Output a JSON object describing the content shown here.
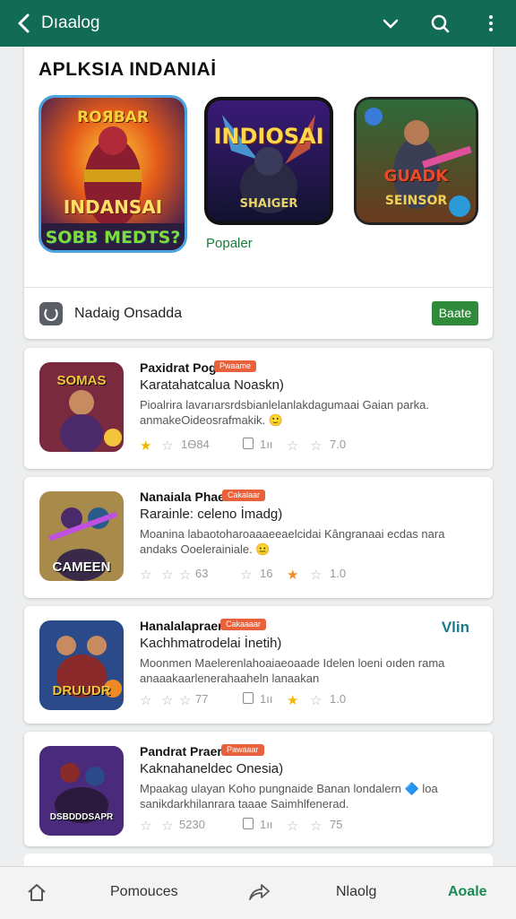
{
  "topbar": {
    "title": "Dıaalog",
    "bg": "#126b55",
    "icons": [
      "back-arrow-icon",
      "chevron-down-icon",
      "search-icon",
      "more-vert-icon"
    ]
  },
  "featured": {
    "heading": "APLKSIA INDANIAİ",
    "banners": [
      {
        "top": "ROЯBAR",
        "mid": "INDANSAI",
        "bottom": "SOBB MEDTS?"
      },
      {
        "top": "INDIOSAI",
        "bottom": "SHAIGER"
      },
      {
        "top": "GUADK",
        "bottom": "SEINSOR"
      }
    ],
    "popular_label": "Popaler",
    "footer_label": "Nadaig Onsadda",
    "button_label": "Baate"
  },
  "items": [
    {
      "name": "Paxidrat Pogr",
      "tag": "Pwaame",
      "subtitle": "Karatahatcalua Noaskn)",
      "desc": "Pioalrira   lavarıarsrdsbianlelanlakdagumaai Gaian parka. anmakeOideosrafmakik.  🙂",
      "thumb_cap": "SOMAS",
      "rating": "1Ѳ84",
      "comments": "1ıı",
      "right_value": "7.0"
    },
    {
      "name": "Nanaiala Phaer",
      "tag": "Cakalaar",
      "subtitle": "Rarainle: celeno İmadg)",
      "desc": "Moanina  labaotoharoaaaeeaelcidai  Kângranaai  ecdas  nara andaks Ooelerainiale.  😐",
      "thumb_cap": "CAMEEN",
      "rating": "63",
      "comments": "16",
      "right_value": "1.0"
    },
    {
      "name": "Hanalalapraer",
      "tag": "Cakaaaar",
      "subtitle": "Kachhmatrodelai İnetih)",
      "desc": "Moonmen  Maelerenlahoaiaeoaade  Idelen  loeni  oıden  rama anaaakaarlenerahaaheln lanaakan",
      "thumb_cap": "DRUUDR",
      "rating": "77",
      "comments": "1ıı",
      "right_value": "1.0",
      "badge": "Vlin"
    },
    {
      "name": "Pandrat Praer",
      "tag": "Pawaaar",
      "subtitle": "Kaknahaneldec Onesia)",
      "desc": "Mpaakag  ulayan  Koho  pungnaide  Banan  londalern  🔷  loa  sanikdarkhilanrara  taaae  Saimhlfenerad.",
      "thumb_cap": "DSBDDDSAPR",
      "rating": "5230",
      "comments": "1ıı",
      "right_value": "75"
    }
  ],
  "bottomnav": {
    "items": [
      "Pomouces",
      "Nlaolg",
      "Aoale"
    ],
    "icons": [
      "home-icon",
      "share-icon"
    ]
  }
}
